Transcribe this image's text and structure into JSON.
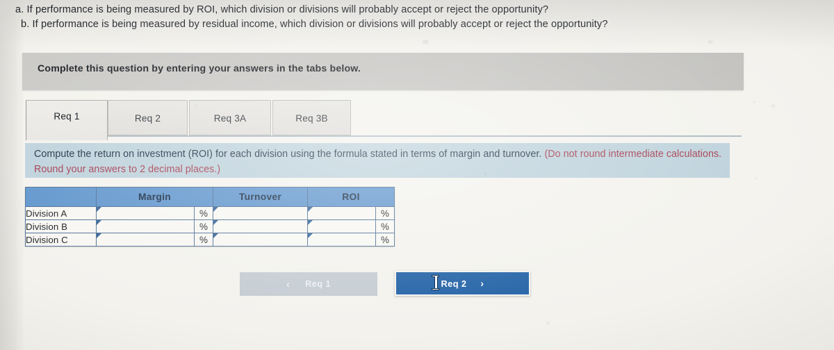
{
  "questions": [
    "a. If performance is being measured by ROI, which division or divisions will probably accept or reject the opportunity?",
    "b. If performance is being measured by residual income, which division or divisions will probably accept or reject the opportunity?"
  ],
  "banner": {
    "complete_text": "Complete this question by entering your answers in the tabs below."
  },
  "tabs": [
    {
      "label": "Req 1",
      "active": true
    },
    {
      "label": "Req 2",
      "active": false
    },
    {
      "label": "Req 3A",
      "active": false
    },
    {
      "label": "Req 3B",
      "active": false
    }
  ],
  "instruction": {
    "main": "Compute the return on investment (ROI) for each division using the formula stated in terms of margin and turnover.",
    "note": "(Do not round intermediate calculations. Round your answers to 2 decimal places.)"
  },
  "table": {
    "corner_header": "",
    "headers": [
      "Margin",
      "Turnover",
      "ROI"
    ],
    "rows": [
      {
        "label": "Division A",
        "margin": "",
        "margin_unit": "%",
        "turnover": "",
        "roi": "",
        "roi_unit": "%"
      },
      {
        "label": "Division B",
        "margin": "",
        "margin_unit": "%",
        "turnover": "",
        "roi": "",
        "roi_unit": "%"
      },
      {
        "label": "Division C",
        "margin": "",
        "margin_unit": "%",
        "turnover": "",
        "roi": "",
        "roi_unit": "%"
      }
    ]
  },
  "nav": {
    "prev_label": "Req 1",
    "prev_chevron": "‹",
    "next_label": "Req 2",
    "next_chevron": "›"
  },
  "colors": {
    "page_background": "#f3f2ed",
    "banner_gray": "#c6c5c2",
    "instruction_band_blue": "#bbd0da",
    "instruction_note_red": "#a13347",
    "table_header_blue": "#5b92cb",
    "table_border_blue": "#4a6c93",
    "next_button_blue": "#1e5fa4",
    "prev_button_gray": "#c3cbd2"
  }
}
